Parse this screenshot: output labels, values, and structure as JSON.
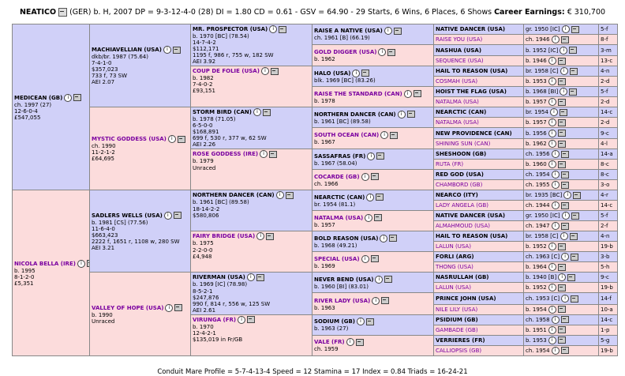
{
  "header": {
    "name": "NEATICO",
    "info": "(GER) b. H, 2007 DP = 9-3-12-4-0 (28) DI = 1.80 CD = 0.61 - GSV = 64.90 - 29 Starts, 6 Wins, 6 Places, 6 Shows",
    "earnings_label": "Career Earnings:",
    "earnings": "€ 310,700"
  },
  "gen1": {
    "sire": {
      "name": "MEDICEAN (GB)",
      "l1": "ch. 1997 (27)",
      "l2": "12-6-0-4",
      "l3": "£547,055"
    },
    "dam": {
      "name": "NICOLA BELLA (IRE)",
      "l1": "b. 1995",
      "l2": "8-1-2-0",
      "l3": "£5,351"
    }
  },
  "gen2": {
    "ss": {
      "name": "MACHIAVELLIAN (USA)",
      "l1": "dkb/br. 1987 (75.64)",
      "l2": "7-4-1-0",
      "l3": "$357,023",
      "l4": "733 f, 73 SW",
      "l5": "AEI 2.07"
    },
    "sd": {
      "name": "MYSTIC GODDESS (USA)",
      "l1": "ch. 1990",
      "l2": "11-2-1-2",
      "l3": "£64,695"
    },
    "ds": {
      "name": "SADLERS WELLS (USA)",
      "l1": "b. 1981 [CS] (77.56)",
      "l2": "11-6-4-0",
      "l3": "$663,423",
      "l4": "2222 f, 1651 r, 1108 w, 280 SW",
      "l5": "AEI 3.21"
    },
    "dd": {
      "name": "VALLEY OF HOPE (USA)",
      "l1": "b. 1990",
      "l2": "Unraced"
    }
  },
  "gen3": [
    {
      "name": "MR. PROSPECTOR (USA)",
      "l1": "b. 1970 [BC] (78.54)",
      "l2": "14-7-4-2",
      "l3": "$112,171",
      "l4": "1195 f, 986 r, 755 w, 182 SW",
      "l5": "AEI 3.92"
    },
    {
      "name": "COUP DE FOLIE (USA)",
      "l1": "b. 1982",
      "l2": "7-4-0-2",
      "l3": "£93,151"
    },
    {
      "name": "STORM BIRD (CAN)",
      "l1": "b. 1978 (71.05)",
      "l2": "6-5-0-0",
      "l3": "$168,891",
      "l4": "699 f, 530 r, 377 w, 62 SW",
      "l5": "AEI 2.26"
    },
    {
      "name": "ROSE GODDESS (IRE)",
      "l1": "b. 1979",
      "l2": "Unraced"
    },
    {
      "name": "NORTHERN DANCER (CAN)",
      "l1": "b. 1961 [BC] (89.58)",
      "l2": "18-14-2-2",
      "l3": "$580,806"
    },
    {
      "name": "FAIRY BRIDGE (USA)",
      "l1": "b. 1975",
      "l2": "2-2-0-0",
      "l3": "£4,948"
    },
    {
      "name": "RIVERMAN (USA)",
      "l1": "b. 1969 [IC] (78.98)",
      "l2": "8-5-2-1",
      "l3": "$247,876",
      "l4": "990 f, 814 r, 556 w, 125 SW",
      "l5": "AEI 2.61"
    },
    {
      "name": "VIRUNGA (FR)",
      "l1": "b. 1970",
      "l2": "12-4-2-1",
      "l3": "$135,019 in Fr/GB"
    }
  ],
  "gen4": [
    {
      "name": "RAISE A NATIVE (USA)",
      "l1": "ch. 1961 [B] (66.19)"
    },
    {
      "name": "GOLD DIGGER (USA)",
      "l1": "b. 1962"
    },
    {
      "name": "HALO (USA)",
      "l1": "blk. 1969 [BC] (83.26)"
    },
    {
      "name": "RAISE THE STANDARD (CAN)",
      "l1": "b. 1978"
    },
    {
      "name": "NORTHERN DANCER (CAN)",
      "l1": "b. 1961 [BC] (89.58)"
    },
    {
      "name": "SOUTH OCEAN (CAN)",
      "l1": "b. 1967"
    },
    {
      "name": "SASSAFRAS (FR)",
      "l1": "b. 1967 (58.04)"
    },
    {
      "name": "COCARDE (GB)",
      "l1": "ch. 1966"
    },
    {
      "name": "NEARCTIC (CAN)",
      "l1": "br. 1954 (81.1)"
    },
    {
      "name": "NATALMA (USA)",
      "l1": "b. 1957"
    },
    {
      "name": "BOLD REASON (USA)",
      "l1": "b. 1968 (49.21)"
    },
    {
      "name": "SPECIAL (USA)",
      "l1": "b. 1969"
    },
    {
      "name": "NEVER BEND (USA)",
      "l1": "b. 1960 [BI] (83.01)"
    },
    {
      "name": "RIVER LADY (USA)",
      "l1": "b. 1963"
    },
    {
      "name": "SODIUM (GB)",
      "l1": "b. 1963 (27)"
    },
    {
      "name": "VALE (FR)",
      "l1": "ch. 1959"
    }
  ],
  "gen5": [
    {
      "name": "NATIVE DANCER (USA)",
      "info": "gr. 1950 [IC]",
      "r": "5-f"
    },
    {
      "name": "RAISE YOU (USA)",
      "info": "ch. 1946",
      "r": "8-f"
    },
    {
      "name": "NASHUA (USA)",
      "info": "b. 1952 [IC]",
      "r": "3-m"
    },
    {
      "name": "SEQUENCE (USA)",
      "info": "b. 1946",
      "r": "13-c"
    },
    {
      "name": "HAIL TO REASON (USA)",
      "info": "br. 1958 [C]",
      "r": "4-n"
    },
    {
      "name": "COSMAH (USA)",
      "info": "b. 1953",
      "r": "2-d"
    },
    {
      "name": "HOIST THE FLAG (USA)",
      "info": "b. 1968 [BI]",
      "r": "5-f"
    },
    {
      "name": "NATALMA (USA)",
      "info": "b. 1957",
      "r": "2-d"
    },
    {
      "name": "NEARCTIC (CAN)",
      "info": "br. 1954",
      "r": "14-c"
    },
    {
      "name": "NATALMA (USA)",
      "info": "b. 1957",
      "r": "2-d"
    },
    {
      "name": "NEW PROVIDENCE (CAN)",
      "info": "b. 1956",
      "r": "9-c"
    },
    {
      "name": "SHINING SUN (CAN)",
      "info": "b. 1962",
      "r": "4-l"
    },
    {
      "name": "SHESHOON (GB)",
      "info": "ch. 1956",
      "r": "14-a"
    },
    {
      "name": "RUTA (FR)",
      "info": "b. 1960",
      "r": "8-c"
    },
    {
      "name": "RED GOD (USA)",
      "info": "ch. 1954",
      "r": "8-c"
    },
    {
      "name": "CHAMBORD (GB)",
      "info": "ch. 1955",
      "r": "3-o"
    },
    {
      "name": "NEARCO (ITY)",
      "info": "br. 1935 [BC]",
      "r": "4-r"
    },
    {
      "name": "LADY ANGELA (GB)",
      "info": "ch. 1944",
      "r": "14-c"
    },
    {
      "name": "NATIVE DANCER (USA)",
      "info": "gr. 1950 [IC]",
      "r": "5-f"
    },
    {
      "name": "ALMAHMOUD (USA)",
      "info": "ch. 1947",
      "r": "2-f"
    },
    {
      "name": "HAIL TO REASON (USA)",
      "info": "br. 1958 [C]",
      "r": "4-n"
    },
    {
      "name": "LALUN (USA)",
      "info": "b. 1952",
      "r": "19-b"
    },
    {
      "name": "FORLI (ARG)",
      "info": "ch. 1963 [C]",
      "r": "3-b"
    },
    {
      "name": "THONG (USA)",
      "info": "b. 1964",
      "r": "5-h"
    },
    {
      "name": "NASRULLAH (GB)",
      "info": "b. 1940 [B]",
      "r": "9-c"
    },
    {
      "name": "LALUN (USA)",
      "info": "b. 1952",
      "r": "19-b"
    },
    {
      "name": "PRINCE JOHN (USA)",
      "info": "ch. 1953 [C]",
      "r": "14-f"
    },
    {
      "name": "NILE LILY (USA)",
      "info": "b. 1954",
      "r": "10-a"
    },
    {
      "name": "PSIDIUM (GB)",
      "info": "ch. 1958",
      "r": "14-c"
    },
    {
      "name": "GAMBADE (GB)",
      "info": "b. 1951",
      "r": "1-p"
    },
    {
      "name": "VERRIERES (FR)",
      "info": "b. 1953",
      "r": "5-g"
    },
    {
      "name": "CALLIOPSIS (GB)",
      "info": "ch. 1954",
      "r": "19-b"
    }
  ],
  "footer": "Conduit Mare Profile = 5-7-4-13-4  Speed = 12  Stamina = 17  Index = 0.84  Triads = 16-24-21",
  "icons": [
    "info-icon",
    "photo-icon"
  ]
}
